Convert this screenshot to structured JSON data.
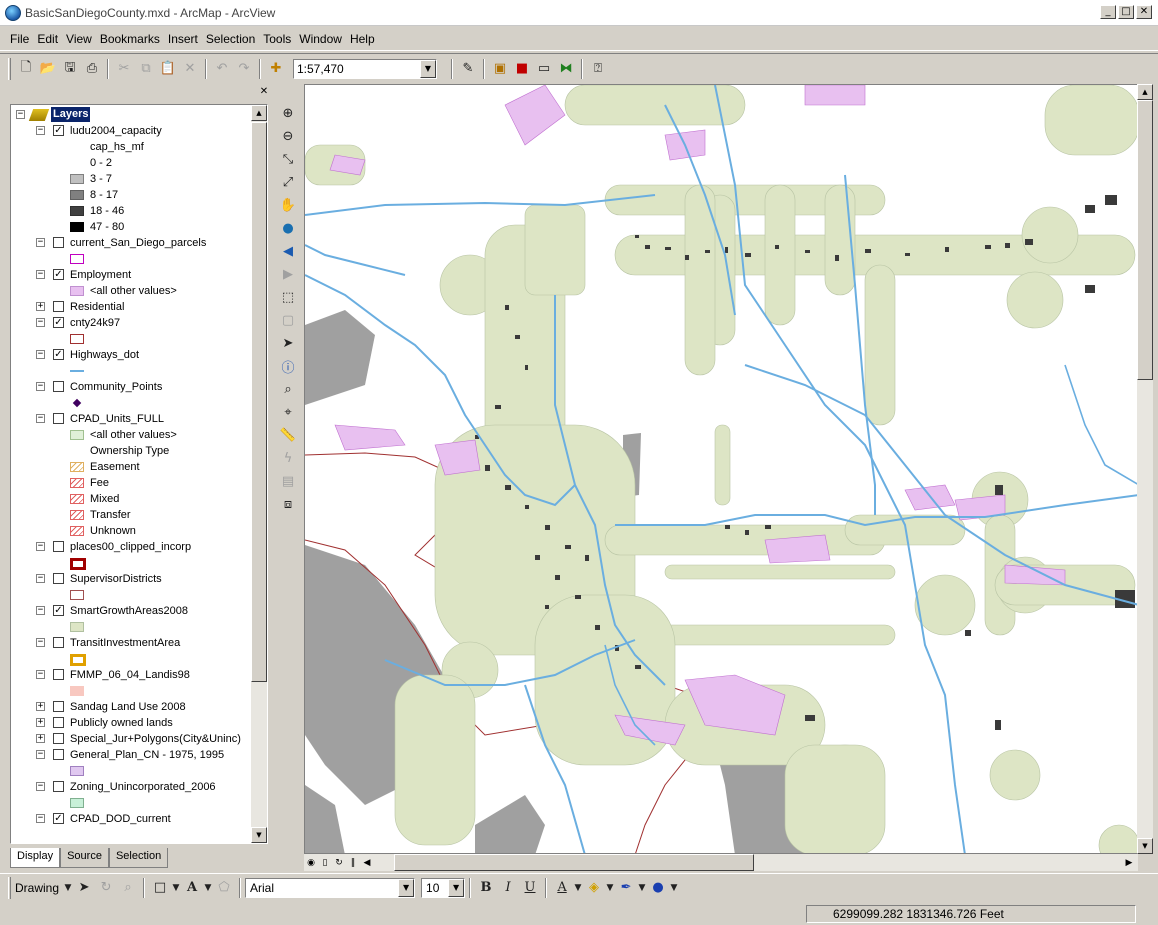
{
  "window": {
    "title": "BasicSanDiegoCounty.mxd - ArcMap - ArcView"
  },
  "menu": [
    "File",
    "Edit",
    "View",
    "Bookmarks",
    "Insert",
    "Selection",
    "Tools",
    "Window",
    "Help"
  ],
  "toolbar": {
    "scale": "1:57,470"
  },
  "toc": {
    "root_label": "Layers",
    "tabs": [
      "Display",
      "Source",
      "Selection"
    ],
    "rows": [
      {
        "kind": "layer",
        "label": "ludu2004_capacity",
        "checked": true,
        "expanded": true
      },
      {
        "kind": "heading",
        "label": "cap_hs_mf"
      },
      {
        "kind": "legend",
        "label": "0 - 2",
        "fill": "#ffffff",
        "stroke": "#ffffff"
      },
      {
        "kind": "legend",
        "label": "3 - 7",
        "fill": "#c0c0c0",
        "stroke": "#808080"
      },
      {
        "kind": "legend",
        "label": "8 - 17",
        "fill": "#808080",
        "stroke": "#606060"
      },
      {
        "kind": "legend",
        "label": "18 - 46",
        "fill": "#404040",
        "stroke": "#303030"
      },
      {
        "kind": "legend",
        "label": "47 - 80",
        "fill": "#000000",
        "stroke": "#000000"
      },
      {
        "kind": "layer",
        "label": "current_San_Diego_parcels",
        "checked": false,
        "expanded": true
      },
      {
        "kind": "legend",
        "label": "",
        "fill": "#ffffff",
        "stroke": "#c000c0"
      },
      {
        "kind": "layer",
        "label": "Employment",
        "checked": true,
        "expanded": true
      },
      {
        "kind": "legend",
        "label": "<all other values>",
        "fill": "#e8c0f0",
        "stroke": "#c090d0"
      },
      {
        "kind": "layer",
        "label": "Residential",
        "checked": false,
        "expanded": false
      },
      {
        "kind": "layer",
        "label": "cnty24k97",
        "checked": true,
        "expanded": true
      },
      {
        "kind": "legend",
        "label": "",
        "fill": "#ffffff",
        "stroke": "#a03030"
      },
      {
        "kind": "layer",
        "label": "Highways_dot",
        "checked": true,
        "expanded": true
      },
      {
        "kind": "line",
        "label": "",
        "stroke": "#6aaee0"
      },
      {
        "kind": "layer",
        "label": "Community_Points",
        "checked": false,
        "expanded": true
      },
      {
        "kind": "point",
        "label": "",
        "fill": "#400060"
      },
      {
        "kind": "layer",
        "label": "CPAD_Units_FULL",
        "checked": false,
        "expanded": true
      },
      {
        "kind": "legend",
        "label": "<all other values>",
        "fill": "#e0f0d8",
        "stroke": "#a0c090"
      },
      {
        "kind": "heading",
        "label": "Ownership Type"
      },
      {
        "kind": "hatch",
        "label": "Easement",
        "stroke": "#e0b060"
      },
      {
        "kind": "hatch",
        "label": "Fee",
        "stroke": "#e06060"
      },
      {
        "kind": "hatch",
        "label": "Mixed",
        "stroke": "#e06060"
      },
      {
        "kind": "hatch",
        "label": "Transfer",
        "stroke": "#e06060"
      },
      {
        "kind": "hatch",
        "label": "Unknown",
        "stroke": "#e06060"
      },
      {
        "kind": "layer",
        "label": "places00_clipped_incorp",
        "checked": false,
        "expanded": true
      },
      {
        "kind": "thick",
        "label": "",
        "fill": "#ffffff",
        "stroke": "#a00000"
      },
      {
        "kind": "layer",
        "label": "SupervisorDistricts",
        "checked": false,
        "expanded": true
      },
      {
        "kind": "legend",
        "label": "",
        "fill": "#ffffff",
        "stroke": "#a05050"
      },
      {
        "kind": "layer",
        "label": "SmartGrowthAreas2008",
        "checked": true,
        "expanded": true
      },
      {
        "kind": "legend",
        "label": "",
        "fill": "#dde5c5",
        "stroke": "#b0c0a0"
      },
      {
        "kind": "layer",
        "label": "TransitInvestmentArea",
        "checked": false,
        "expanded": true
      },
      {
        "kind": "thick",
        "label": "",
        "fill": "#ffffff",
        "stroke": "#e0a000"
      },
      {
        "kind": "layer",
        "label": "FMMP_06_04_Landis98",
        "checked": false,
        "expanded": true
      },
      {
        "kind": "legend",
        "label": "",
        "fill": "#f8c8c0",
        "stroke": "#f8c8c0"
      },
      {
        "kind": "layer",
        "label": "Sandag Land Use 2008",
        "checked": false,
        "expanded": false
      },
      {
        "kind": "layer",
        "label": "Publicly owned lands",
        "checked": false,
        "expanded": false
      },
      {
        "kind": "layer",
        "label": "Special_Jur+Polygons(City&Uninc)",
        "checked": false,
        "expanded": false
      },
      {
        "kind": "layer",
        "label": "General_Plan_CN - 1975, 1995",
        "checked": false,
        "expanded": true
      },
      {
        "kind": "legend",
        "label": "",
        "fill": "#e0c8f0",
        "stroke": "#a080c0"
      },
      {
        "kind": "layer",
        "label": "Zoning_Unincorporated_2006",
        "checked": false,
        "expanded": true
      },
      {
        "kind": "legend",
        "label": "",
        "fill": "#c8f0d8",
        "stroke": "#80b090"
      },
      {
        "kind": "layer",
        "label": "CPAD_DOD_current",
        "checked": true,
        "expanded": true
      }
    ]
  },
  "drawing": {
    "label": "Drawing",
    "font": "Arial",
    "size": "10"
  },
  "status": {
    "coords": "6299099.282  1831346.726 Feet"
  },
  "colors": {
    "smart_growth": "#dde5c5",
    "employment": "#e8c0f0",
    "highway": "#6aaee0",
    "water": "#ffffff",
    "land_gray": "#a0a0a0",
    "county_line": "#a03030"
  }
}
